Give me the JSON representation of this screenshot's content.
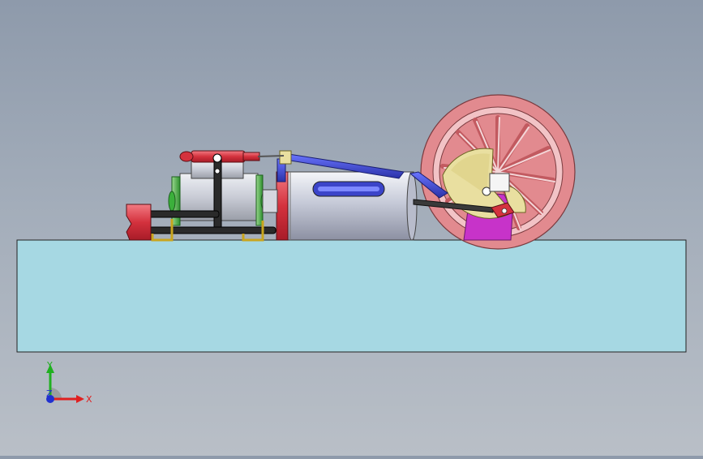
{
  "viewport": {
    "colors": {
      "background_top": "#8e9aab",
      "background_bottom": "#b9bfc7",
      "base_fill": "#a6d8e3",
      "flywheel": "#e28a8f",
      "crank_disk": "#e9dfa0",
      "cylinder": "#c8ccd8",
      "connecting_rod": "#3f49c8",
      "flame_holder": "#cc2e3a",
      "support_bracket": "#c733c9",
      "green_flange": "#3bb03b",
      "pipe": "#222222"
    }
  },
  "triad": {
    "x_label": "X",
    "y_label": "Y",
    "z_label": "Z",
    "x_color": "#e02020",
    "y_color": "#20b020",
    "z_color": "#2030d0"
  }
}
